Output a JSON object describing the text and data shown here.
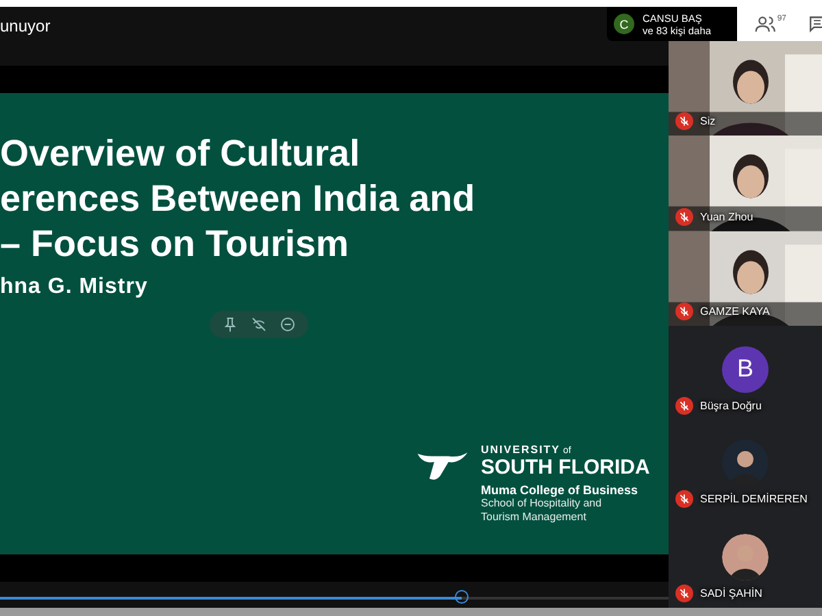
{
  "header": {
    "title": "unuyor"
  },
  "notification": {
    "initial": "C",
    "name": "CANSU BAŞ",
    "detail": "ve 83 kişi daha"
  },
  "toolbar": {
    "participant_count": "97"
  },
  "slide": {
    "title_lines": [
      "Overview of Cultural",
      "erences Between India and",
      "– Focus on Tourism"
    ],
    "author": "hna G. Mistry",
    "logo": {
      "top": "UNIVERSITY",
      "of": "of",
      "main": "SOUTH FLORIDA",
      "college": "Muma College of Business",
      "school_lines": [
        "School of Hospitality and",
        "Tourism Management"
      ]
    }
  },
  "progress": {
    "level": 0.69
  },
  "participants": [
    {
      "name": "Siz",
      "kind": "video",
      "muted": true
    },
    {
      "name": "Yuan Zhou",
      "kind": "video",
      "muted": true
    },
    {
      "name": "GAMZE KAYA",
      "kind": "video",
      "muted": true
    },
    {
      "name": "Büşra Doğru",
      "kind": "letter",
      "letter": "B",
      "muted": true
    },
    {
      "name": "SERPİL DEMİREREN",
      "muted": true
    },
    {
      "name": "SADİ ŞAHİN",
      "muted": true
    }
  ]
}
